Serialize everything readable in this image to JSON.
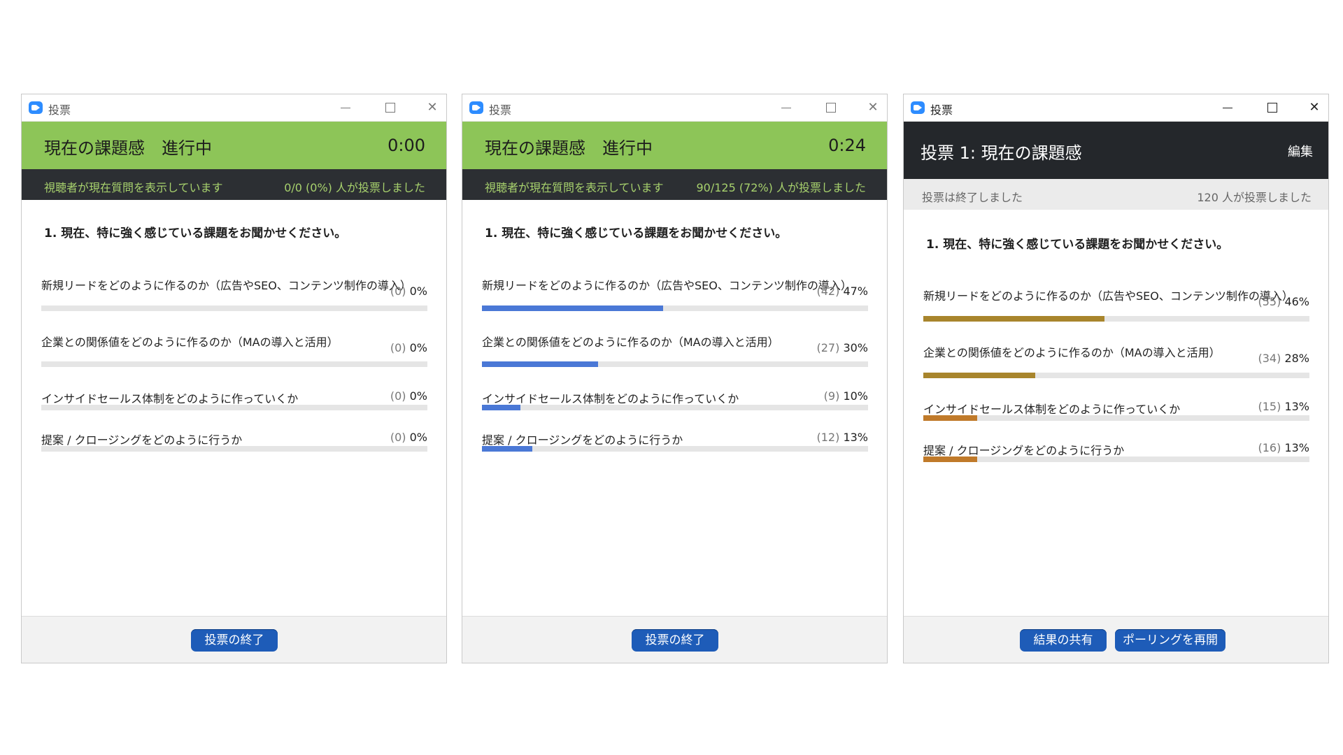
{
  "windows": [
    {
      "title": "投票",
      "header": {
        "title": "現在の課題感　進行中",
        "time": "0:00"
      },
      "status": {
        "left": "視聴者が現在質問を表示しています",
        "right": "0/0 (0%) 人が投票しました"
      },
      "question": "1. 現在、特に強く感じている課題をお聞かせください。",
      "bar_color": "#4a78d6",
      "options": [
        {
          "label": "新規リードをどのように作るのか（広告やSEO、コンテンツ制作の導入）",
          "count": "(0)",
          "pct": "0%",
          "fraction": 0
        },
        {
          "label": "企業との関係値をどのように作るのか（MAの導入と活用）",
          "count": "(0)",
          "pct": "0%",
          "fraction": 0
        },
        {
          "label": "インサイドセールス体制をどのように作っていくか",
          "count": "(0)",
          "pct": "0%",
          "fraction": 0
        },
        {
          "label": "提案 / クロージングをどのように行うか",
          "count": "(0)",
          "pct": "0%",
          "fraction": 0
        }
      ],
      "buttons": [
        {
          "label": "投票の終了"
        }
      ]
    },
    {
      "title": "投票",
      "header": {
        "title": "現在の課題感　進行中",
        "time": "0:24"
      },
      "status": {
        "left": "視聴者が現在質問を表示しています",
        "right": "90/125 (72%) 人が投票しました"
      },
      "question": "1. 現在、特に強く感じている課題をお聞かせください。",
      "bar_color": "#4a78d6",
      "options": [
        {
          "label": "新規リードをどのように作るのか（広告やSEO、コンテンツ制作の導入）",
          "count": "(42)",
          "pct": "47%",
          "fraction": 0.47
        },
        {
          "label": "企業との関係値をどのように作るのか（MAの導入と活用）",
          "count": "(27)",
          "pct": "30%",
          "fraction": 0.3
        },
        {
          "label": "インサイドセールス体制をどのように作っていくか",
          "count": "(9)",
          "pct": "10%",
          "fraction": 0.1
        },
        {
          "label": "提案 / クロージングをどのように行うか",
          "count": "(12)",
          "pct": "13%",
          "fraction": 0.13
        }
      ],
      "buttons": [
        {
          "label": "投票の終了"
        }
      ]
    },
    {
      "title": "投票",
      "header": {
        "title": "投票 1: 現在の課題感",
        "edit": "編集"
      },
      "status": {
        "left": "投票は終了しました",
        "right": "120 人が投票しました"
      },
      "question": "1. 現在、特に強く感じている課題をお聞かせください。",
      "bar_colors": [
        "#a8852c",
        "#a8852c",
        "#c07a2a",
        "#c07a2a"
      ],
      "options": [
        {
          "label": "新規リードをどのように作るのか（広告やSEO、コンテンツ制作の導入）",
          "count": "(55)",
          "pct": "46%",
          "fraction": 0.47
        },
        {
          "label": "企業との関係値をどのように作るのか（MAの導入と活用）",
          "count": "(34)",
          "pct": "28%",
          "fraction": 0.29
        },
        {
          "label": "インサイドセールス体制をどのように作っていくか",
          "count": "(15)",
          "pct": "13%",
          "fraction": 0.14
        },
        {
          "label": "提案 / クロージングをどのように行うか",
          "count": "(16)",
          "pct": "13%",
          "fraction": 0.14
        }
      ],
      "buttons": [
        {
          "label": "結果の共有"
        },
        {
          "label": "ポーリングを再開"
        }
      ]
    }
  ]
}
